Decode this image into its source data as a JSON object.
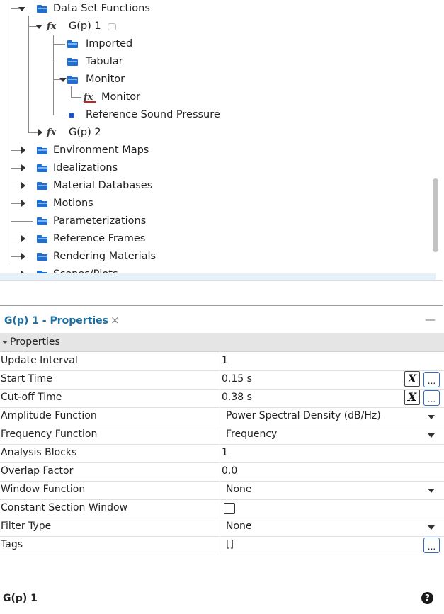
{
  "tree": {
    "items": [
      {
        "label": "Data Set Functions",
        "icon": "folder-icon",
        "expanded": true
      },
      {
        "label": "G(p) 1",
        "icon": "fx-icon",
        "expanded": true,
        "selected": true
      },
      {
        "label": "Imported",
        "icon": "folder-icon"
      },
      {
        "label": "Tabular",
        "icon": "folder-icon"
      },
      {
        "label": "Monitor",
        "icon": "folder-icon",
        "expanded": true
      },
      {
        "label": "Monitor",
        "icon": "fx-red-icon"
      },
      {
        "label": "Reference Sound Pressure",
        "icon": "dot-icon"
      },
      {
        "label": "G(p) 2",
        "icon": "fx-icon",
        "expanded": false
      },
      {
        "label": "Environment Maps",
        "icon": "folder-icon",
        "expanded": false
      },
      {
        "label": "Idealizations",
        "icon": "folder-icon",
        "expanded": false
      },
      {
        "label": "Material Databases",
        "icon": "folder-icon",
        "expanded": false
      },
      {
        "label": "Motions",
        "icon": "folder-icon",
        "expanded": false
      },
      {
        "label": "Parameterizations",
        "icon": "folder-icon"
      },
      {
        "label": "Reference Frames",
        "icon": "folder-icon",
        "expanded": false
      },
      {
        "label": "Rendering Materials",
        "icon": "folder-icon",
        "expanded": false
      },
      {
        "label": "Scenes/Plots",
        "icon": "folder-icon",
        "expanded": false
      }
    ]
  },
  "properties": {
    "tab_title": "G(p) 1 - Properties",
    "close_glyph": "×",
    "minimize_glyph": "—",
    "section_label": "Properties",
    "rows": [
      {
        "name": "Update Interval",
        "value": "1"
      },
      {
        "name": "Start Time",
        "value": "0.15 s",
        "has_x_button": true,
        "has_ellipsis": true
      },
      {
        "name": "Cut-off Time",
        "value": "0.38 s",
        "has_x_button": true,
        "has_ellipsis": true
      },
      {
        "name": "Amplitude Function",
        "value": "Power Spectral Density (dB/Hz)",
        "dropdown": true
      },
      {
        "name": "Frequency Function",
        "value": "Frequency",
        "dropdown": true
      },
      {
        "name": "Analysis Blocks",
        "value": "1"
      },
      {
        "name": "Overlap Factor",
        "value": "0.0"
      },
      {
        "name": "Window Function",
        "value": "None",
        "dropdown": true
      },
      {
        "name": "Constant Section Window",
        "value": "",
        "checkbox": true,
        "checked": false
      },
      {
        "name": "Filter Type",
        "value": "None",
        "dropdown": true
      },
      {
        "name": "Tags",
        "value": "[]",
        "has_ellipsis": true
      }
    ],
    "x_button_glyph": "X",
    "ellipsis_glyph": "..."
  },
  "status": {
    "title": "G(p) 1",
    "help_glyph": "?"
  }
}
